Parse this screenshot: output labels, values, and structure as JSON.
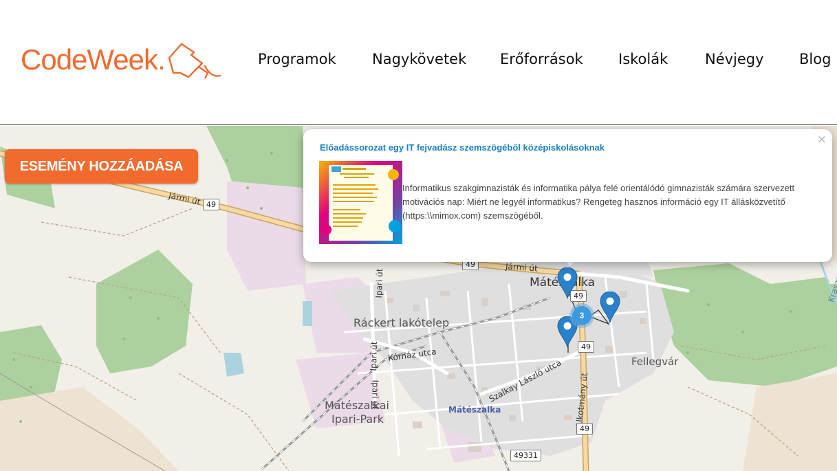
{
  "header": {
    "logo_text": "CodeWeek.",
    "nav": [
      {
        "label": "Programok"
      },
      {
        "label": "Nagykövetek"
      },
      {
        "label": "Erőforrások"
      },
      {
        "label": "Iskolák"
      },
      {
        "label": "Névjegy"
      },
      {
        "label": "Blog"
      }
    ]
  },
  "map": {
    "add_event_label": "ESEMÉNY HOZZÁADÁSA",
    "places": {
      "city": "Mátészalka",
      "district": "Ráckert lakótelep",
      "industrial_park_1": "Mátészalkai",
      "industrial_park_2": "Ipari-Park",
      "fellegvar": "Fellegvár",
      "city_small": "Mátészalka"
    },
    "roads": {
      "jarmi_ut_1": "Jármi út",
      "jarmi_ut_2": "Jármi út",
      "ipari_ut_1": "Ipari út",
      "ipari_ut_2": "Ipari út",
      "ipari_ut_3": "Ipari út",
      "korhaz_utca": "Kórház utca",
      "szalkay_utca": "Szalkay László utca",
      "alkotmany_ut": "Alkotmány út",
      "kraszna": "Kraszn"
    },
    "shields": {
      "s49_a": "49",
      "s49_b": "49",
      "s49_c": "49",
      "s49_d": "49",
      "s49_e": "49",
      "s49331": "49331"
    },
    "cluster_count": "3",
    "popup": {
      "title": "Előadássorozat egy IT fejvadász szemszögéből középiskolásoknak",
      "description": "Informatikus szakgimnazisták és informatika pálya felé orientálódó gimnazisták számára szervezett motivációs nap: Miért ne legyél informatikus? Rengeteg hasznos információ egy IT állásközvetítő (https:\\\\mimox.com) szemszögéből.",
      "close": "×"
    }
  },
  "colors": {
    "brand_orange": "#f26a2e",
    "popup_title_blue": "#1b80c0",
    "marker_blue": "#2a81cb",
    "forest_green": "#add19e",
    "residential_grey": "#e0dfdf"
  }
}
